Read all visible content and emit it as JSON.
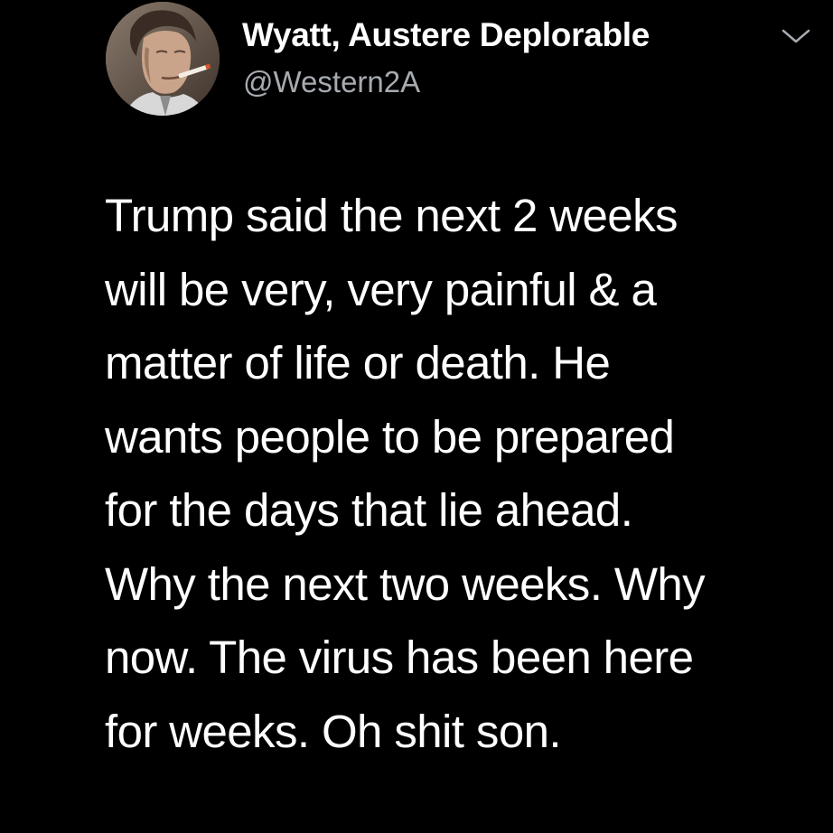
{
  "tweet": {
    "author": {
      "display_name": "Wyatt, Austere Deplorable",
      "handle": "@Western2A"
    },
    "menu_icon": "chevron-down-icon",
    "text_lines": [
      "Trump said the next 2 weeks",
      "will be very, very painful & a",
      "matter of life or death. He",
      "wants people to be prepared",
      "for the days that lie ahead.",
      "Why the next two weeks. Why",
      "now. The virus has been here",
      "for weeks. Oh shit son."
    ]
  },
  "colors": {
    "background": "#000000",
    "text": "#ffffff",
    "secondary_text": "#a7abb0"
  }
}
